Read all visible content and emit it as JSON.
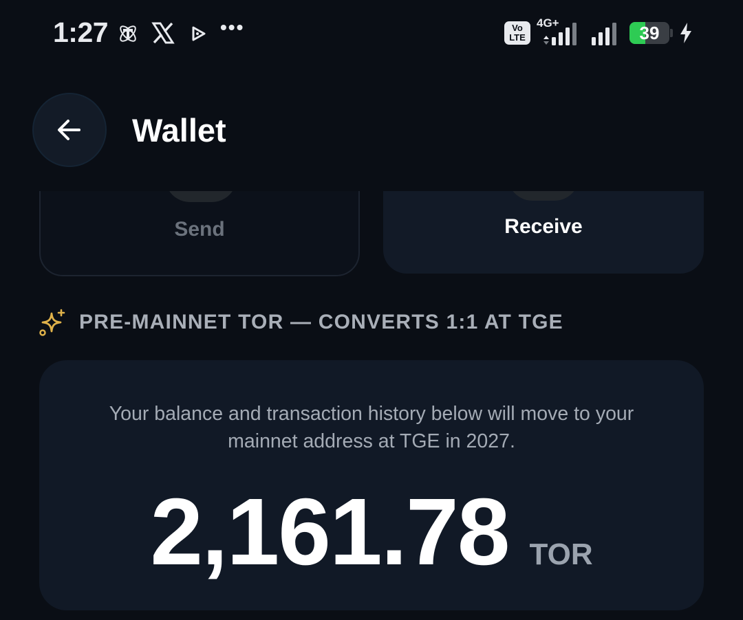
{
  "status_bar": {
    "time": "1:27",
    "notification_icons": [
      "tor-app-icon",
      "x-icon",
      "play-icon"
    ],
    "more_indicator": "•••",
    "volte_line1": "Vo",
    "volte_line2": "LTE",
    "network_type": "4G+",
    "battery_level": "39",
    "battery_fraction": 0.39,
    "battery_fill_color": "#2ecb54",
    "charging": true
  },
  "header": {
    "title": "Wallet",
    "back_icon": "arrow-left-icon"
  },
  "actions": {
    "send_label": "Send",
    "receive_label": "Receive"
  },
  "section": {
    "heading": "PRE-MAINNET TOR — CONVERTS 1:1 AT TGE",
    "icon": "sparkle-icon",
    "icon_color": "#e0b24a"
  },
  "balance": {
    "note": "Your balance and transaction history below will move to your mainnet address at TGE in 2027.",
    "amount": "2,161.78",
    "unit": "TOR"
  },
  "colors": {
    "background": "#0a0e15",
    "card": "#111926",
    "muted_text": "#a4abb5"
  }
}
